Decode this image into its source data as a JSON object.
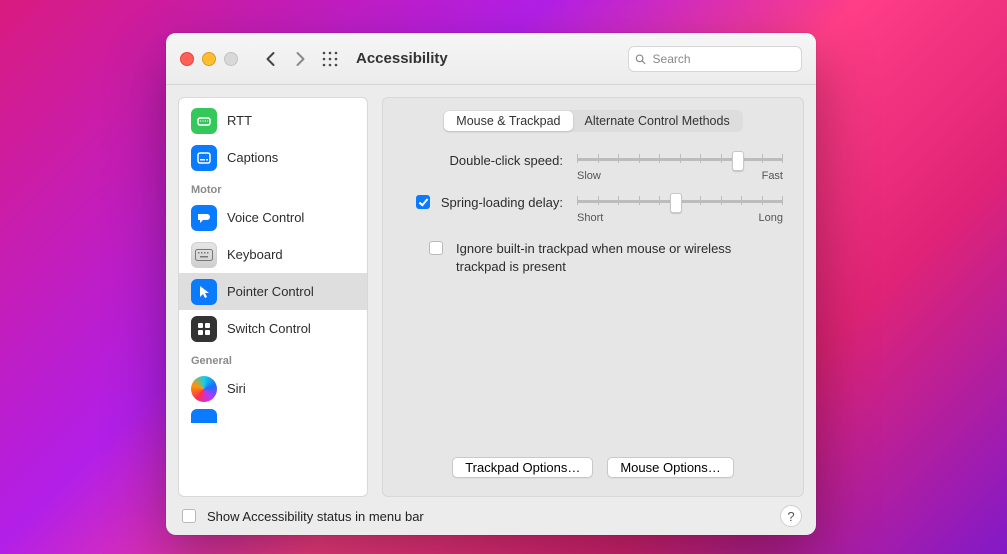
{
  "window": {
    "title": "Accessibility",
    "search_placeholder": "Search"
  },
  "sidebar": {
    "items_top": [
      {
        "label": "RTT",
        "icon": "rtt-icon",
        "bg": "bg-green"
      },
      {
        "label": "Captions",
        "icon": "captions-icon",
        "bg": "bg-blue"
      }
    ],
    "cat_motor": "Motor",
    "items_motor": [
      {
        "label": "Voice Control",
        "icon": "voice-control-icon",
        "bg": "bg-blue"
      },
      {
        "label": "Keyboard",
        "icon": "keyboard-icon",
        "bg": "bg-grey"
      },
      {
        "label": "Pointer Control",
        "icon": "pointer-control-icon",
        "bg": "bg-blue",
        "selected": true
      },
      {
        "label": "Switch Control",
        "icon": "switch-control-icon",
        "bg": "bg-darkgrey"
      }
    ],
    "cat_general": "General",
    "items_general": [
      {
        "label": "Siri",
        "icon": "siri-icon",
        "bg": "bg-siri"
      }
    ]
  },
  "main": {
    "tabs": [
      {
        "label": "Mouse & Trackpad",
        "active": true
      },
      {
        "label": "Alternate Control Methods",
        "active": false
      }
    ],
    "double_click_label": "Double-click speed:",
    "double_click_min": "Slow",
    "double_click_max": "Fast",
    "double_click_value": 0.78,
    "spring_label": "Spring-loading delay:",
    "spring_enabled": true,
    "spring_min": "Short",
    "spring_max": "Long",
    "spring_value": 0.48,
    "ignore_trackpad_label": "Ignore built-in trackpad when mouse or wireless trackpad is present",
    "ignore_trackpad_checked": false,
    "trackpad_options_btn": "Trackpad Options…",
    "mouse_options_btn": "Mouse Options…"
  },
  "footer": {
    "status_label": "Show Accessibility status in menu bar",
    "status_checked": false,
    "help": "?"
  }
}
